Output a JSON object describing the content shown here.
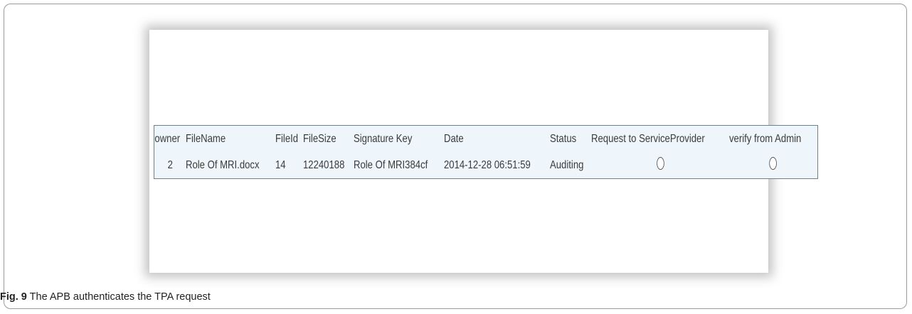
{
  "table": {
    "headers": {
      "owner": "owner",
      "file_name": "FileName",
      "file_id": "FileId",
      "file_size": "FileSize",
      "signature_key": "Signature Key",
      "date": "Date",
      "status": "Status",
      "request_to_service_provider": "Request to ServiceProvider",
      "verify_from_admin": "verify from Admin"
    },
    "rows": [
      {
        "owner": "2",
        "file_name": "Role Of MRI.docx",
        "file_id": "14",
        "file_size": "12240188",
        "signature_key": "Role Of MRI384cf",
        "date": "2014-12-28 06:51:59",
        "status": "Auditing",
        "request_to_service_provider": "unselected",
        "verify_from_admin": "unselected"
      }
    ]
  },
  "caption": {
    "label": "Fig. 9",
    "text": "The APB authenticates the TPA request"
  }
}
